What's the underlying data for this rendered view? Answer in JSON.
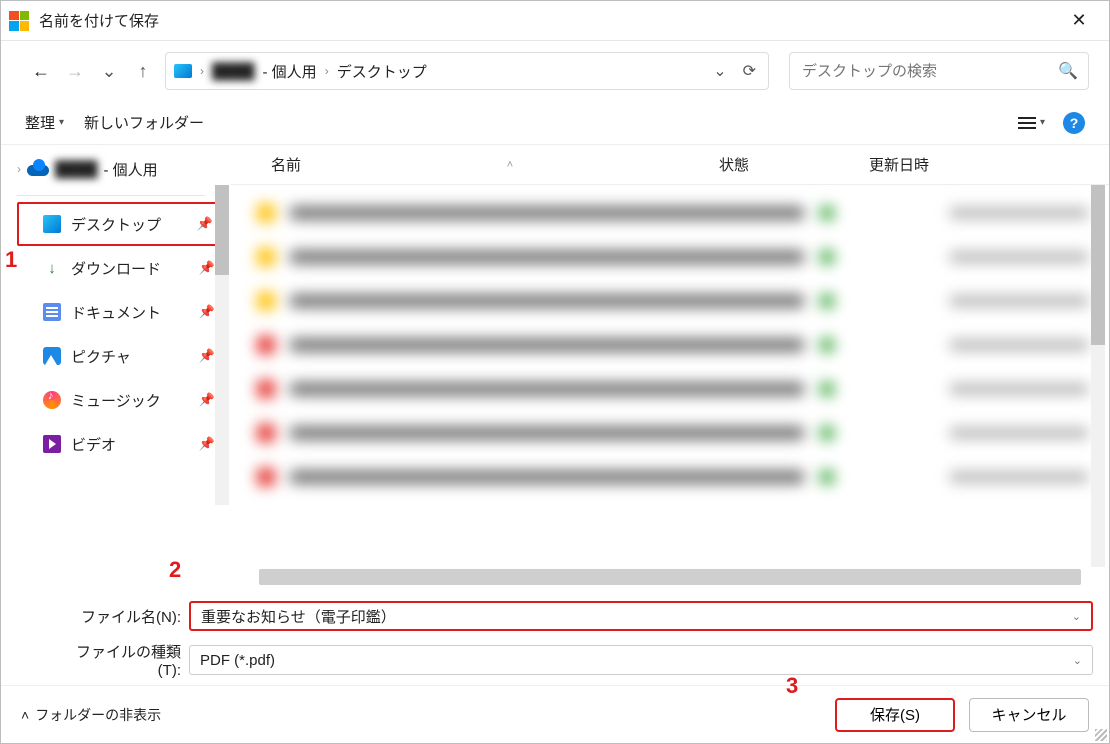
{
  "title": "名前を付けて保存",
  "breadcrumb": {
    "hidden": "████",
    "personal_suffix": " - 個人用",
    "current": "デスクトップ"
  },
  "search": {
    "placeholder": "デスクトップの検索"
  },
  "toolbar": {
    "organize": "整理",
    "new_folder": "新しいフォルダー"
  },
  "tree_top": {
    "hidden": "████",
    "personal_suffix": " - 個人用"
  },
  "sidebar": {
    "items": [
      {
        "label": "デスクトップ"
      },
      {
        "label": "ダウンロード"
      },
      {
        "label": "ドキュメント"
      },
      {
        "label": "ピクチャ"
      },
      {
        "label": "ミュージック"
      },
      {
        "label": "ビデオ"
      }
    ]
  },
  "columns": {
    "name": "名前",
    "state": "状態",
    "date": "更新日時"
  },
  "fields": {
    "filename_label": "ファイル名(N):",
    "filename_value": "重要なお知らせ（電子印鑑）",
    "filetype_label": "ファイルの種類(T):",
    "filetype_value": "PDF (*.pdf)"
  },
  "footer": {
    "hide_folders": "フォルダーの非表示",
    "save": "保存(S)",
    "cancel": "キャンセル"
  },
  "annotations": {
    "a1": "1",
    "a2": "2",
    "a3": "3"
  }
}
